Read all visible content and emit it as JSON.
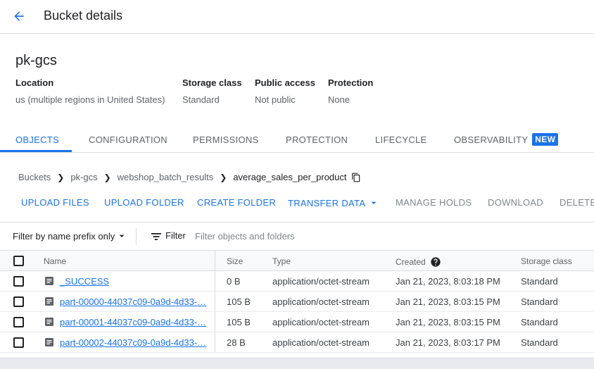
{
  "header": {
    "title": "Bucket details",
    "back_icon": "arrow-back-icon"
  },
  "bucket": {
    "name": "pk-gcs",
    "meta": [
      {
        "label": "Location",
        "value": "us (multiple regions in United States)"
      },
      {
        "label": "Storage class",
        "value": "Standard"
      },
      {
        "label": "Public access",
        "value": "Not public"
      },
      {
        "label": "Protection",
        "value": "None"
      }
    ]
  },
  "tabs": [
    {
      "label": "OBJECTS",
      "active": true
    },
    {
      "label": "CONFIGURATION"
    },
    {
      "label": "PERMISSIONS"
    },
    {
      "label": "PROTECTION"
    },
    {
      "label": "LIFECYCLE"
    },
    {
      "label": "OBSERVABILITY",
      "badge": "NEW"
    }
  ],
  "breadcrumb": [
    "Buckets",
    "pk-gcs",
    "webshop_batch_results",
    "average_sales_per_product"
  ],
  "toolbar": {
    "upload_files": "UPLOAD FILES",
    "upload_folder": "UPLOAD FOLDER",
    "create_folder": "CREATE FOLDER",
    "transfer_data": "TRANSFER DATA",
    "manage_holds": "MANAGE HOLDS",
    "download": "DOWNLOAD",
    "delete": "DELETE"
  },
  "filter": {
    "prefix_label": "Filter by name prefix only",
    "label": "Filter",
    "placeholder": "Filter objects and folders"
  },
  "table": {
    "columns": [
      "Name",
      "Size",
      "Type",
      "Created",
      "Storage class"
    ],
    "rows": [
      {
        "name": "_SUCCESS",
        "size": "0 B",
        "type": "application/octet-stream",
        "created": "Jan 21, 2023, 8:03:18 PM",
        "storage_class": "Standard"
      },
      {
        "name": "part-00000-44037c09-0a9d-4d33-…",
        "size": "105 B",
        "type": "application/octet-stream",
        "created": "Jan 21, 2023, 8:03:15 PM",
        "storage_class": "Standard"
      },
      {
        "name": "part-00001-44037c09-0a9d-4d33-…",
        "size": "105 B",
        "type": "application/octet-stream",
        "created": "Jan 21, 2023, 8:03:15 PM",
        "storage_class": "Standard"
      },
      {
        "name": "part-00002-44037c09-0a9d-4d33-…",
        "size": "28 B",
        "type": "application/octet-stream",
        "created": "Jan 21, 2023, 8:03:17 PM",
        "storage_class": "Standard"
      }
    ]
  },
  "colors": {
    "accent": "#1a73e8",
    "text": "#202124",
    "muted": "#5f6368",
    "border": "#dadce0"
  }
}
